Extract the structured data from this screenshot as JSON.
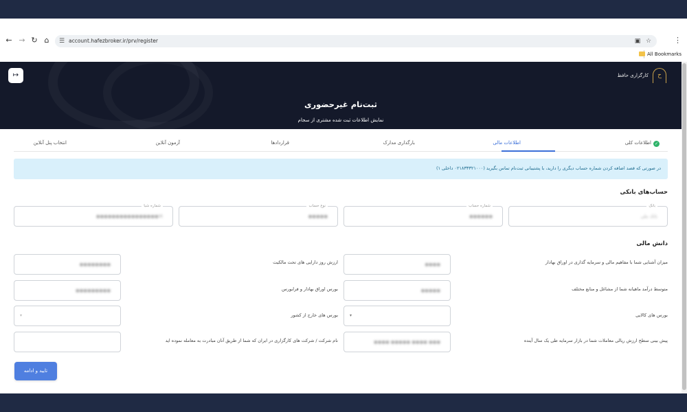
{
  "browser": {
    "url": "account.hafezbroker.ir/prv/register",
    "bookmarks_label": "All Bookmarks"
  },
  "hero": {
    "brand": "کارگزاری حافظ",
    "title": "ثبت‌نام غیرحضوری",
    "subtitle": "نمایش اطلاعات ثبت شده مشتری از سجام"
  },
  "tabs": [
    {
      "label": "اطلاعات کلی",
      "status": "completed"
    },
    {
      "label": "اطلاعات مالی",
      "status": "active"
    },
    {
      "label": "بارگذاری مدارک",
      "status": "pending"
    },
    {
      "label": "قراردادها",
      "status": "pending"
    },
    {
      "label": "آزمون آنلاین",
      "status": "pending"
    },
    {
      "label": "انتخاب پنل آنلاین",
      "status": "pending"
    }
  ],
  "alert": {
    "text": "در صورتی که قصد اضافه کردن شماره حساب دیگری را دارید، با پشتیبانی ثبت‌نام تماس بگیرید (۰۲۱۸۳۳۳۲۱۰۰۰ داخلی ۱)"
  },
  "bank_section": {
    "title": "حساب‌های بانکی",
    "fields": [
      {
        "label": "بانک",
        "value": "بانک ملی"
      },
      {
        "label": "شماره حساب",
        "value": "●●●●●●"
      },
      {
        "label": "نوع حساب",
        "value": "●●●●●"
      },
      {
        "label": "شماره شبا",
        "value": "IR●●●●●●●●●●●●●●●●"
      }
    ]
  },
  "financial_section": {
    "title": "دانش مالی",
    "right_questions": [
      {
        "label": "میزان آشنایی شما با مفاهیم مالی و سرمایه گذاری در اوراق بهادار",
        "value": "●●●●",
        "type": "input"
      },
      {
        "label": "متوسط درآمد ماهیانه شما از مشاغل و منابع مختلف",
        "value": "●●●●●",
        "type": "input"
      },
      {
        "label": "بورس های کالایی",
        "value": "",
        "type": "select"
      },
      {
        "label": "پیش بینی سطح ارزش ریالی معاملات شما در بازار سرمایه طی یک سال آینده",
        "value": "●●● ●●●● ●●●●● ●●●●",
        "type": "input"
      }
    ],
    "left_questions": [
      {
        "label": "ارزش روز دارایی های تحت مالکیت",
        "value": "●●●●●●●●",
        "type": "input"
      },
      {
        "label": "بورس اوراق بهادار و فرابورس",
        "value": "●●●●●●●●●",
        "type": "input"
      },
      {
        "label": "بورس های خارج از کشور",
        "value": "",
        "type": "select"
      },
      {
        "label": "نام شرکت / شرکت های کارگزاری در ایران که شما از طریق آنان مبادرت به معامله نموده اید",
        "value": "",
        "type": "input"
      }
    ]
  },
  "submit_label": "تایید و ادامه",
  "colors": {
    "hero_bg": "#14192a",
    "accent": "#3b6fd8",
    "alert_bg": "#d9f0fb",
    "success": "#2fb36a"
  }
}
